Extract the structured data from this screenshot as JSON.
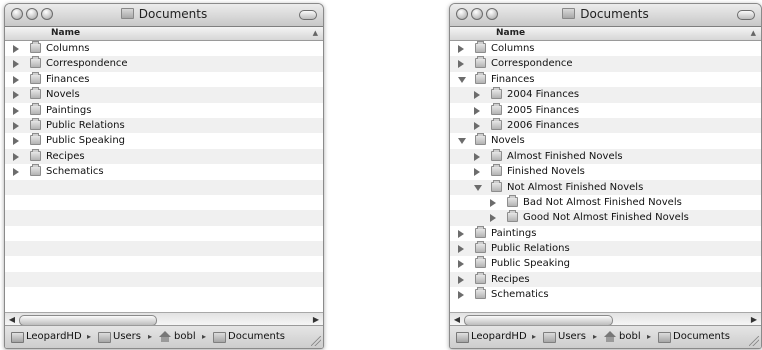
{
  "left_window": {
    "title": "Documents",
    "column_header": "Name",
    "rows": [
      {
        "label": "Columns",
        "depth": 0,
        "expanded": false
      },
      {
        "label": "Correspondence",
        "depth": 0,
        "expanded": false
      },
      {
        "label": "Finances",
        "depth": 0,
        "expanded": false
      },
      {
        "label": "Novels",
        "depth": 0,
        "expanded": false
      },
      {
        "label": "Paintings",
        "depth": 0,
        "expanded": false
      },
      {
        "label": "Public Relations",
        "depth": 0,
        "expanded": false
      },
      {
        "label": "Public Speaking",
        "depth": 0,
        "expanded": false
      },
      {
        "label": "Recipes",
        "depth": 0,
        "expanded": false
      },
      {
        "label": "Schematics",
        "depth": 0,
        "expanded": false
      }
    ],
    "path": [
      "LeopardHD",
      "Users",
      "bobl",
      "Documents"
    ]
  },
  "right_window": {
    "title": "Documents",
    "column_header": "Name",
    "rows": [
      {
        "label": "Columns",
        "depth": 0,
        "expanded": false
      },
      {
        "label": "Correspondence",
        "depth": 0,
        "expanded": false
      },
      {
        "label": "Finances",
        "depth": 0,
        "expanded": true
      },
      {
        "label": "2004 Finances",
        "depth": 1,
        "expanded": false
      },
      {
        "label": "2005 Finances",
        "depth": 1,
        "expanded": false
      },
      {
        "label": "2006 Finances",
        "depth": 1,
        "expanded": false
      },
      {
        "label": "Novels",
        "depth": 0,
        "expanded": true
      },
      {
        "label": "Almost Finished Novels",
        "depth": 1,
        "expanded": false
      },
      {
        "label": "Finished Novels",
        "depth": 1,
        "expanded": false
      },
      {
        "label": "Not Almost Finished Novels",
        "depth": 1,
        "expanded": true
      },
      {
        "label": "Bad Not Almost Finished Novels",
        "depth": 2,
        "expanded": false
      },
      {
        "label": "Good Not Almost Finished Novels",
        "depth": 2,
        "expanded": false
      },
      {
        "label": "Paintings",
        "depth": 0,
        "expanded": false
      },
      {
        "label": "Public Relations",
        "depth": 0,
        "expanded": false
      },
      {
        "label": "Public Speaking",
        "depth": 0,
        "expanded": false
      },
      {
        "label": "Recipes",
        "depth": 0,
        "expanded": false
      },
      {
        "label": "Schematics",
        "depth": 0,
        "expanded": false
      }
    ],
    "path": [
      "LeopardHD",
      "Users",
      "bobl",
      "Documents"
    ]
  }
}
